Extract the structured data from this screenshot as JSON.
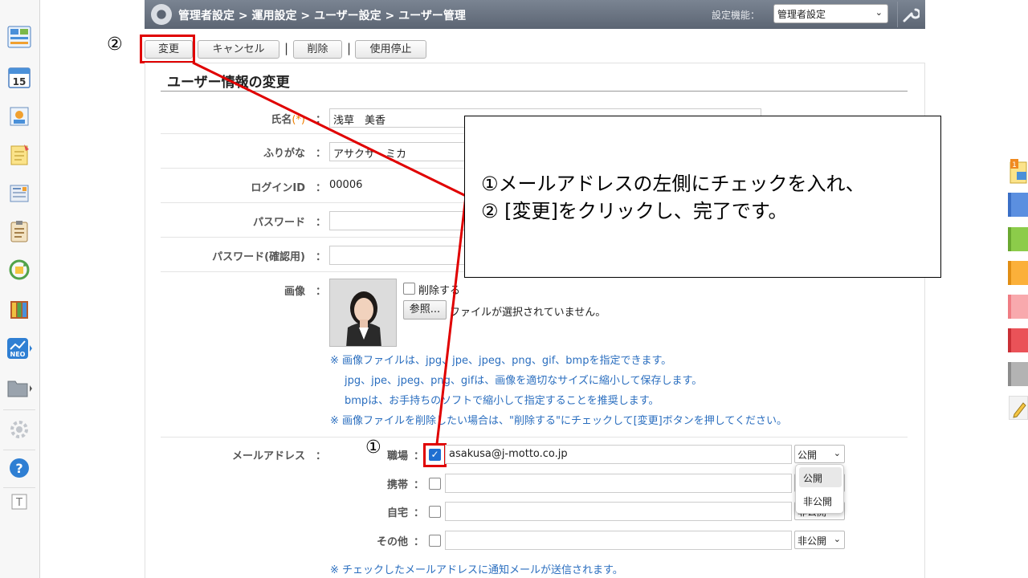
{
  "header": {
    "breadcrumb": "管理者設定 > 運用設定 > ユーザー設定 > ユーザー管理",
    "setting_label": "設定機能：",
    "setting_value": "管理者設定"
  },
  "annotations": {
    "step1": "①",
    "step2": "②"
  },
  "toolbar": {
    "change_label": "変更",
    "cancel_label": "キャンセル",
    "separator": "|",
    "delete_label": "削除",
    "suspend_label": "使用停止"
  },
  "form": {
    "title": "ユーザー情報の変更",
    "name": {
      "label": "氏名",
      "required_mark": "(*)",
      "colon": "：",
      "value": "浅草　美香"
    },
    "furigana": {
      "label": "ふりがな",
      "colon": "：",
      "value": "アサクサ　ミカ"
    },
    "login_id": {
      "label": "ログインID",
      "colon": "：",
      "value": "00006"
    },
    "password": {
      "label": "パスワード",
      "colon": "：",
      "value": ""
    },
    "password_confirm": {
      "label": "パスワード(確認用)",
      "colon": "：",
      "value": ""
    },
    "image": {
      "label": "画像",
      "colon": "：",
      "delete_checkbox_label": "削除する",
      "browse_label": "参照...",
      "no_file_text": "ファイルが選択されていません。",
      "notes": [
        "※ 画像ファイルは、jpg、jpe、jpeg、png、gif、bmpを指定できます。",
        "jpg、jpe、jpeg、png、gifは、画像を適切なサイズに縮小して保存します。",
        "bmpは、お手持ちのソフトで縮小して指定することを推奨します。",
        "※ 画像ファイルを削除したい場合は、\"削除する\"にチェックして[変更]ボタンを押してください。"
      ]
    },
    "email": {
      "label": "メールアドレス",
      "colon": "：",
      "rows": [
        {
          "label": "職場",
          "checked": true,
          "value": "asakusa@j-motto.co.jp",
          "visibility": "公開"
        },
        {
          "label": "携帯",
          "checked": false,
          "value": "",
          "visibility": ""
        },
        {
          "label": "自宅",
          "checked": false,
          "value": "",
          "visibility": "非公開"
        },
        {
          "label": "その他",
          "checked": false,
          "value": "",
          "visibility": "非公開"
        }
      ],
      "dropdown_options": [
        "公開",
        "非公開"
      ],
      "note": "※ チェックしたメールアドレスに通知メールが送信されます。"
    }
  },
  "callout": {
    "line1": "①メールアドレスの左側にチェックを入れ、",
    "line2": "② [変更]をクリックし、完了です。"
  },
  "colors": {
    "highlight": "#e00000",
    "note_blue": "#2a6ebf",
    "header": "#6b7482",
    "checkbox": "#1f6fd1"
  },
  "right_tabs": [
    "notification-icon",
    "blue-tab",
    "green-tab",
    "orange-tab",
    "pink-tab",
    "red-tab",
    "gray-tab",
    "pencil-icon"
  ]
}
